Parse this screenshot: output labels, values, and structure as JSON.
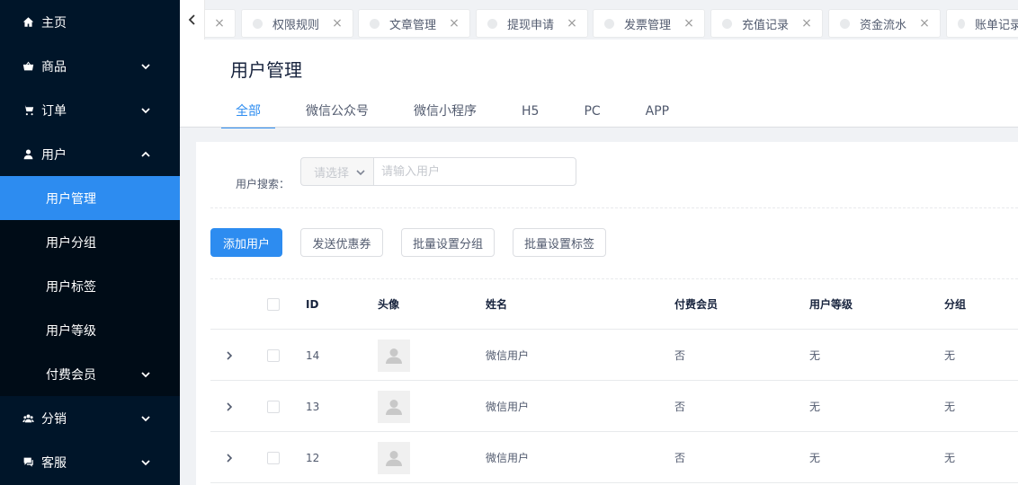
{
  "sidebar": {
    "items": [
      {
        "label": "主页",
        "icon": "home-icon"
      },
      {
        "label": "商品",
        "icon": "basket-icon"
      },
      {
        "label": "订单",
        "icon": "cart-icon"
      },
      {
        "label": "用户",
        "icon": "user-icon"
      }
    ],
    "user_sub": [
      {
        "label": "用户管理"
      },
      {
        "label": "用户分组"
      },
      {
        "label": "用户标签"
      },
      {
        "label": "用户等级"
      },
      {
        "label": "付费会员"
      }
    ],
    "bottom": [
      {
        "label": "分销",
        "icon": "group-icon"
      },
      {
        "label": "客服",
        "icon": "chat-icon"
      }
    ]
  },
  "tabs": [
    {
      "label": "权限规则"
    },
    {
      "label": "文章管理"
    },
    {
      "label": "提现申请"
    },
    {
      "label": "发票管理"
    },
    {
      "label": "充值记录"
    },
    {
      "label": "资金流水"
    },
    {
      "label": "账单记录"
    }
  ],
  "page": {
    "title": "用户管理",
    "segments": [
      "全部",
      "微信公众号",
      "微信小程序",
      "H5",
      "PC",
      "APP"
    ]
  },
  "search": {
    "label": "用户搜索：",
    "select_placeholder": "请选择",
    "input_placeholder": "请输入用户"
  },
  "actions": {
    "add": "添加用户",
    "coupon": "发送优惠券",
    "group": "批量设置分组",
    "tag": "批量设置标签"
  },
  "table": {
    "headers": {
      "id": "ID",
      "avatar": "头像",
      "name": "姓名",
      "paid": "付费会员",
      "level": "用户等级",
      "group": "分组"
    },
    "rows": [
      {
        "id": "14",
        "name": "微信用户",
        "paid": "否",
        "level": "无",
        "group": "无"
      },
      {
        "id": "13",
        "name": "微信用户",
        "paid": "否",
        "level": "无",
        "group": "无"
      },
      {
        "id": "12",
        "name": "微信用户",
        "paid": "否",
        "level": "无",
        "group": "无"
      }
    ]
  },
  "colors": {
    "sidebar_bg": "#001529",
    "accent": "#2d8cf0"
  }
}
